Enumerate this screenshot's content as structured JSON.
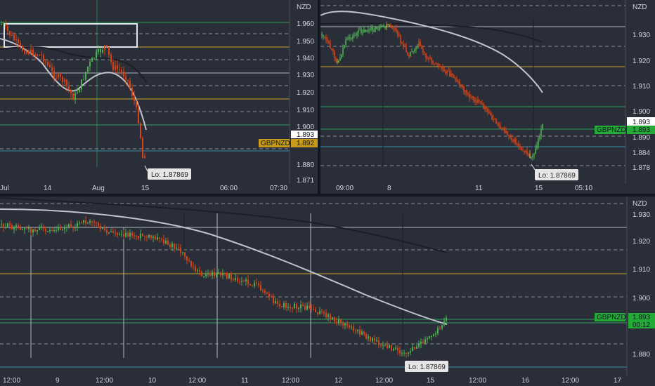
{
  "symbol": "GBPNZD",
  "currency": "NZD",
  "colors": {
    "bg": "#2a2e39",
    "grid_dash": "#8a8e99",
    "hline_white": "#b2b5be",
    "hline_yellow": "#c9a227",
    "hline_green": "#2e9e5a",
    "hline_teal": "#3a8ea8",
    "up": "#4caf50",
    "down": "#d84315",
    "mid": "#c8a038",
    "ma_light": "#c0c3cc",
    "ma_dark": "#1c1f26",
    "tag_green": "#22ab35",
    "tag_gold": "#c79a17",
    "tag_white": "#ffffff"
  },
  "panels": {
    "top_left": {
      "price_ticks": [
        "1.960",
        "1.950",
        "1.940",
        "1.930",
        "1.920",
        "1.910",
        "1.900",
        "1.880",
        "1.871"
      ],
      "time_ticks": [
        "Jul",
        "14",
        "Aug",
        "15",
        "06:00",
        "07:30"
      ],
      "price_label_white": "1.893",
      "price_label_gold": "1.892",
      "symbol_tag": "GBPNZD",
      "lo_label": "Lo: 1.87869"
    },
    "top_right": {
      "price_ticks": [
        "1.930",
        "1.920",
        "1.910",
        "1.900",
        "1.890",
        "1.884",
        "1.878"
      ],
      "time_ticks": [
        "09:00",
        "8",
        "11",
        "15",
        "05:10"
      ],
      "price_label_white": "1.893",
      "price_label_green": "1.893",
      "symbol_tag": "GBPNZD",
      "lo_label": "Lo: 1.87869"
    },
    "bottom": {
      "price_ticks": [
        "1.930",
        "1.920",
        "1.910",
        "1.900",
        "1.880"
      ],
      "time_ticks": [
        "12:00",
        "9",
        "12:00",
        "10",
        "12:00",
        "11",
        "12:00",
        "12",
        "12:00",
        "15",
        "12:00",
        "16",
        "12:00",
        "17"
      ],
      "price_label_green": "1.893",
      "countdown": "00:12",
      "symbol_tag": "GBPNZD",
      "lo_label": "Lo: 1.87869"
    }
  }
}
